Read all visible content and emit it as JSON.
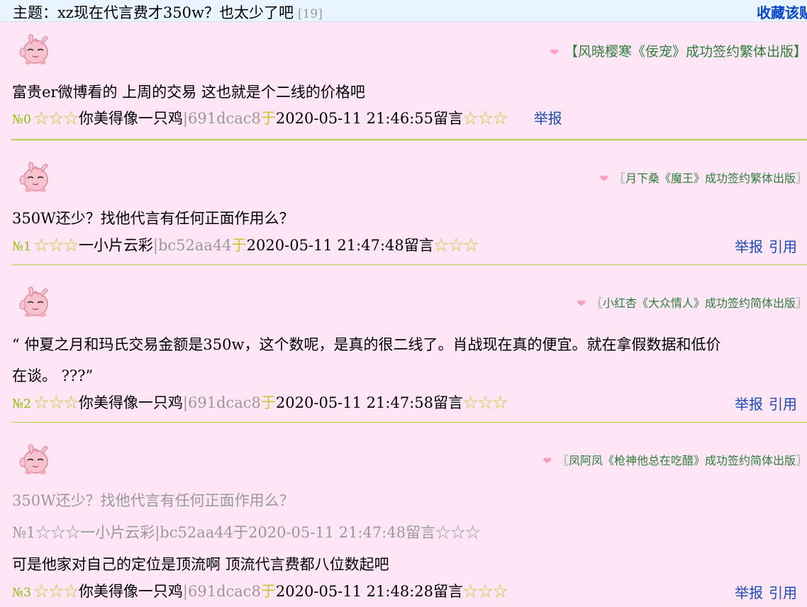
{
  "topic": {
    "prefix": "主题：",
    "title": "xz现在代言费才350w？也太少了吧",
    "reply_count": "[19]",
    "favorite_label": "收藏该贴"
  },
  "posts": [
    {
      "signature": "【风晓樱寒《佞宠》成功签约繁体出版】",
      "content": "富贵er微博看的 上周的交易 这也就是个二线的价格吧",
      "no": "№0",
      "stars_left": "☆☆☆",
      "author": "你美得像一只鸡",
      "uid": "|691dcac8",
      "yu": "于",
      "time": "2020-05-11 21:46:55",
      "suffix": "留言",
      "stars_right": "☆☆☆",
      "report": "举报"
    },
    {
      "signature": "〖月下桑《魔王》成功签约繁体出版〗",
      "content": "350W还少？找他代言有任何正面作用么？",
      "no": "№1",
      "stars_left": "☆☆☆",
      "author": "一小片云彩",
      "uid": "|bc52aa44",
      "yu": "于",
      "time": "2020-05-11 21:47:48",
      "suffix": "留言",
      "stars_right": "☆☆☆",
      "report": "举报",
      "quote_link": "引用"
    },
    {
      "signature": "〖小红杏《大众情人》成功签约简体出版〗",
      "content_line1": "“ 仲夏之月和玛氏交易金额是350w，这个数呢，是真的很二线了。肖战现在真的便宜。就在拿假数据和低价",
      "content_line2": "在谈。 ???”",
      "no": "№2",
      "stars_left": "☆☆☆",
      "author": "你美得像一只鸡",
      "uid": "|691dcac8",
      "yu": "于",
      "time": "2020-05-11 21:47:58",
      "suffix": "留言",
      "stars_right": "☆☆☆",
      "report": "举报",
      "quote_link": "引用"
    },
    {
      "signature": "〖凤阿凤《枪神他总在吃醋》成功签约简体出版〗",
      "quote_content": "350W还少？找他代言有任何正面作用么？",
      "quote_meta": "№1☆☆☆一小片云彩|bc52aa44于2020-05-11 21:47:48留言☆☆☆",
      "content": "可是他家对自己的定位是顶流啊 顶流代言费都八位数起吧",
      "no": "№3",
      "stars_left": "☆☆☆",
      "author": "你美得像一只鸡",
      "uid": "|691dcac8",
      "yu": "于",
      "time": "2020-05-11 21:48:28",
      "suffix": "留言",
      "stars_right": "☆☆☆",
      "report": "举报",
      "quote_link": "引用"
    }
  ]
}
